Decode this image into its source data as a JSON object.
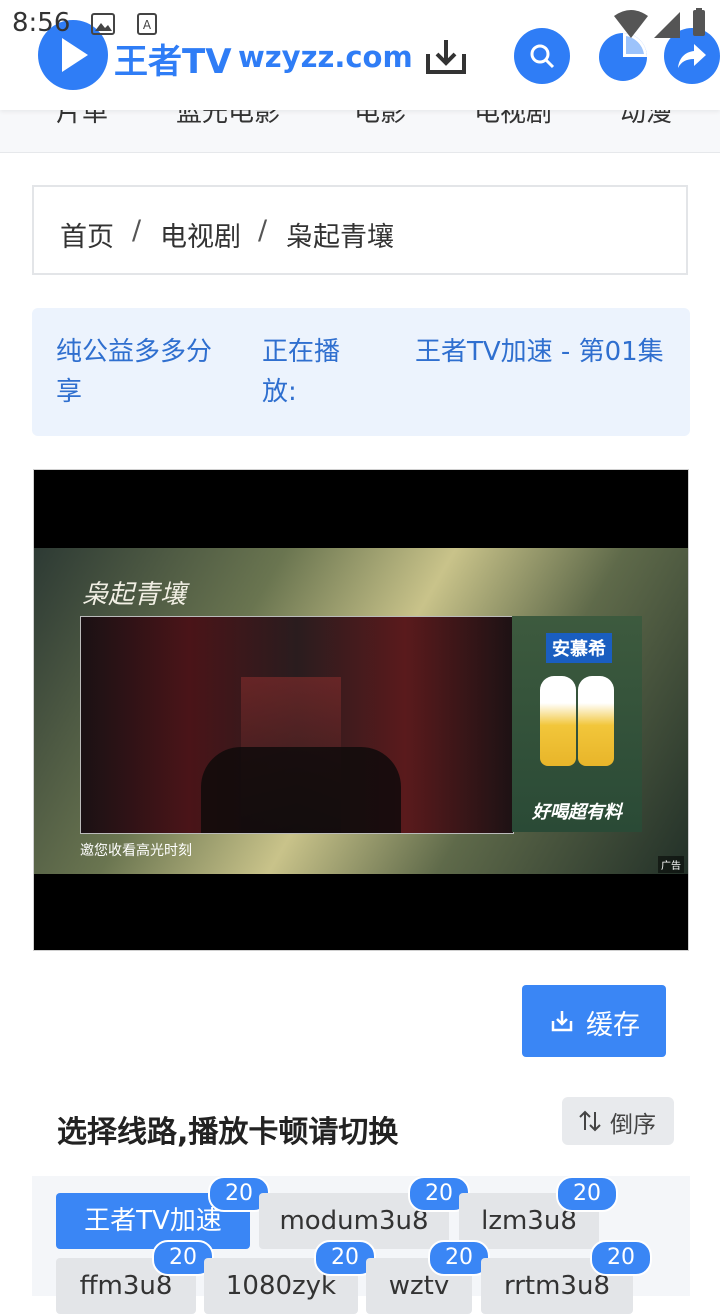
{
  "status_bar": {
    "time": "8:56"
  },
  "header": {
    "brand_name": "王者TV",
    "brand_domain": "wzyzz.com",
    "nav": [
      "片单",
      "蓝光电影",
      "电影",
      "电视剧",
      "动漫"
    ]
  },
  "breadcrumb": [
    "首页",
    "电视剧",
    "枭起青壤"
  ],
  "breadcrumb_separator": "/",
  "info": {
    "share_text": "纯公益多多分享",
    "now_playing_label": "正在播放:",
    "now_playing_value": "王者TV加速 - 第01集"
  },
  "video": {
    "show_title": "枭起青壤",
    "caption": "邀您收看高光时刻",
    "ad_tag": "广告",
    "ad_brand": "安慕希",
    "ad_slogan": "好喝超有料"
  },
  "cache_button": {
    "label": "缓存"
  },
  "routes": {
    "title": "选择线路,播放卡顿请切换",
    "sort_label": "倒序",
    "tabs": [
      {
        "label": "王者TV加速",
        "count": "20"
      },
      {
        "label": "modum3u8",
        "count": "20"
      },
      {
        "label": "lzm3u8",
        "count": "20"
      },
      {
        "label": "ffm3u8",
        "count": "20"
      },
      {
        "label": "1080zyk",
        "count": "20"
      },
      {
        "label": "wztv",
        "count": "20"
      },
      {
        "label": "rrtm3u8",
        "count": "20"
      }
    ]
  },
  "colors": {
    "accent": "#2f7df6",
    "info_bg": "#ecf3fd",
    "button": "#3a86f5"
  }
}
